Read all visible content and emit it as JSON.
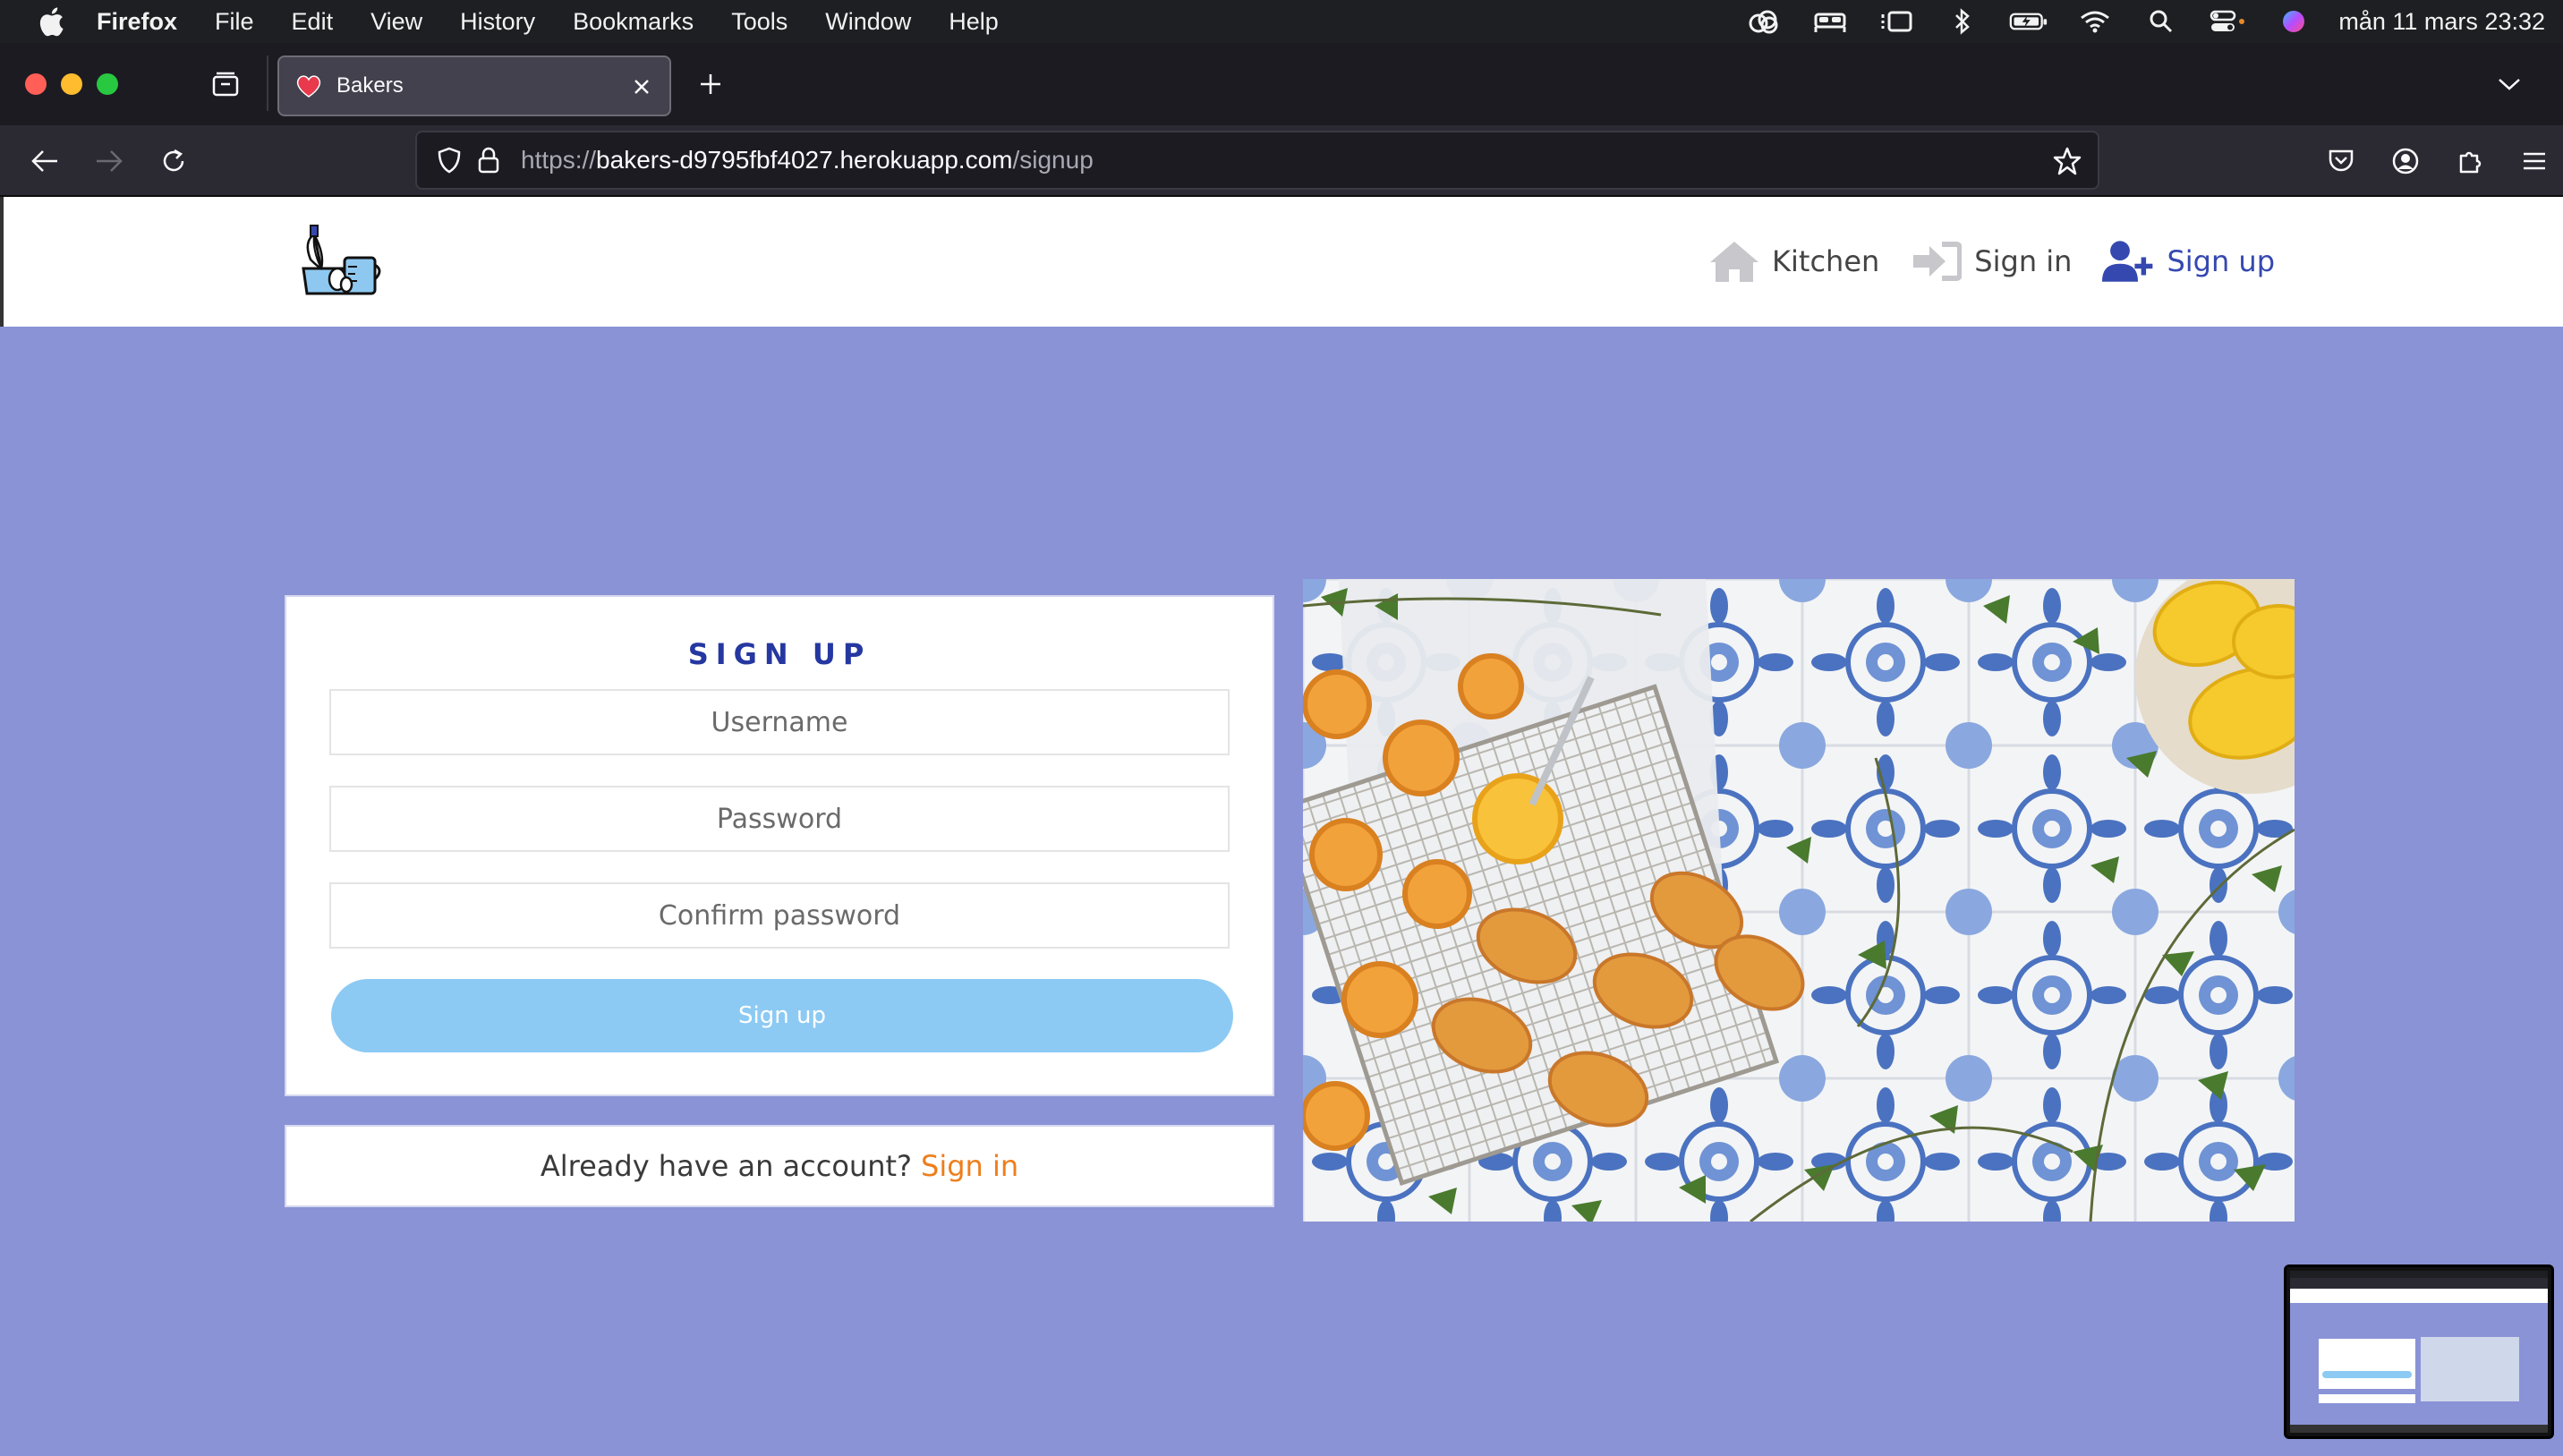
{
  "menubar": {
    "app_name": "Firefox",
    "items": [
      "File",
      "Edit",
      "View",
      "History",
      "Bookmarks",
      "Tools",
      "Window",
      "Help"
    ],
    "status_icons": [
      "creative-cloud-icon",
      "bed-icon",
      "stage-manager-icon",
      "bluetooth-icon",
      "battery-icon",
      "wifi-icon",
      "spotlight-search-icon",
      "control-center-icon",
      "siri-icon"
    ],
    "clock": "mån 11 mars 23:32"
  },
  "browser": {
    "tab": {
      "title": "Bakers"
    },
    "url": {
      "scheme": "https://",
      "host": "bakers-d9795fbf4027.herokuapp.com",
      "path": "/signup"
    }
  },
  "site": {
    "nav": [
      {
        "label": "Kitchen",
        "icon": "house-icon"
      },
      {
        "label": "Sign in",
        "icon": "sign-in-arrow-icon"
      },
      {
        "label": "Sign up",
        "icon": "user-plus-icon",
        "active": true
      }
    ],
    "form": {
      "heading": "SIGN UP",
      "username_placeholder": "Username",
      "password_placeholder": "Password",
      "confirm_placeholder": "Confirm password",
      "submit_label": "Sign up"
    },
    "signin_prompt": {
      "text": "Already have an account?",
      "link": "Sign in"
    }
  },
  "colors": {
    "page_background": "#8a93d6",
    "accent_blue": "#3548b0",
    "button_blue": "#8ccaf4",
    "link_orange": "#ee7e1c"
  }
}
